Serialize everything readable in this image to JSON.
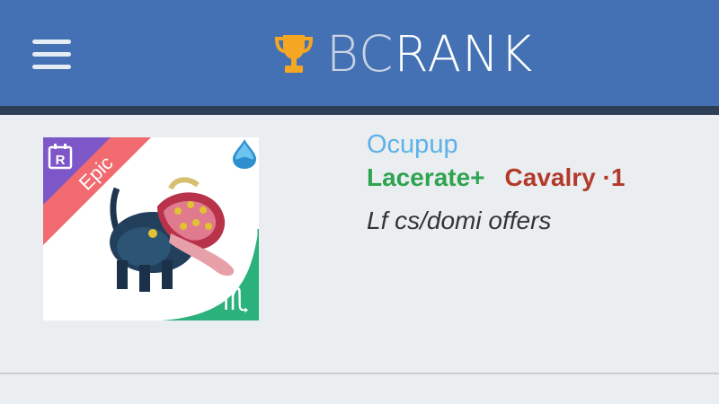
{
  "header": {
    "menu_icon": "hamburger-menu-icon",
    "logo_icon": "trophy-icon",
    "brand_prefix": "BC",
    "brand_suffix": "RANK",
    "bar_color": "#4470b4",
    "trophy_color": "#f5a623"
  },
  "listing": {
    "name": "Ocupup",
    "skill": "Lacerate+",
    "role": "Cavalry",
    "separator": "·",
    "level": "1",
    "note": "Lf cs/domi offers",
    "rarity": "Epic",
    "rarity_color": "#f06a6f",
    "r_badge": "R",
    "element_icon": "water-drop-icon",
    "sign_icon": "scorpio-sign-icon",
    "name_color": "#5cb2e9",
    "skill_color": "#2ea451",
    "role_color": "#b23a2b"
  }
}
